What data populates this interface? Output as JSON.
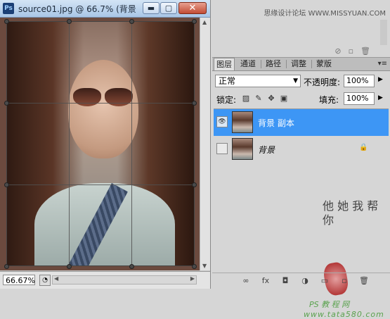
{
  "document": {
    "app_icon": "Ps",
    "title": "source01.jpg @ 66.7% (背景",
    "window_buttons": {
      "minimize": "▬",
      "maximize": "▢",
      "close": "✕"
    },
    "zoom": "66.67%"
  },
  "watermark": "思缘设计论坛 WWW.MISSYUAN.COM",
  "layers_panel": {
    "tabs": [
      "图层",
      "通道",
      "路径",
      "调整",
      "蒙版"
    ],
    "active_tab": "图层",
    "blend_mode": "正常",
    "opacity_label": "不透明度:",
    "opacity_value": "100%",
    "lock_label": "锁定:",
    "fill_label": "填充:",
    "fill_value": "100%",
    "layers": [
      {
        "name": "背景 副本",
        "selected": true,
        "visible": true
      },
      {
        "name": "背景",
        "selected": false,
        "visible": false,
        "locked": true
      }
    ]
  },
  "signature": {
    "text": "他 她 我 帮 你",
    "brand_line1": "PS 教 程 网",
    "brand_line2": "www.tata580.com"
  }
}
